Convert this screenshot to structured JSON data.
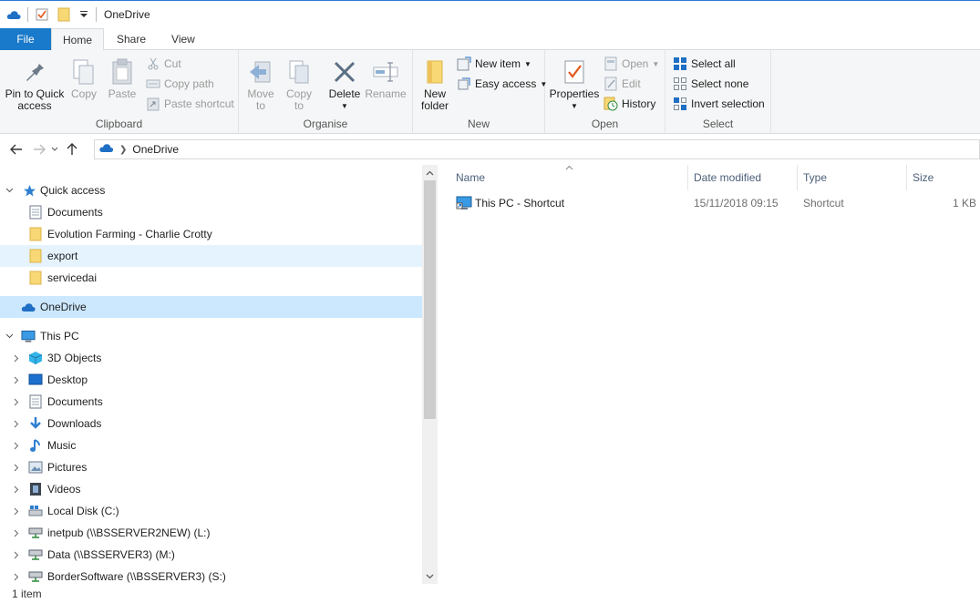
{
  "window": {
    "title": "OneDrive"
  },
  "tabs": [
    {
      "label": "File"
    },
    {
      "label": "Home"
    },
    {
      "label": "Share"
    },
    {
      "label": "View"
    }
  ],
  "ribbon": {
    "clipboard": {
      "label": "Clipboard",
      "pin_line1": "Pin to Quick",
      "pin_line2": "access",
      "copy": "Copy",
      "paste": "Paste",
      "cut": "Cut",
      "copy_path": "Copy path",
      "paste_shortcut": "Paste shortcut"
    },
    "organise": {
      "label": "Organise",
      "move_to": "Move",
      "move_to2": "to",
      "copy_to": "Copy",
      "copy_to2": "to",
      "delete": "Delete",
      "rename": "Rename"
    },
    "new": {
      "label": "New",
      "new_folder1": "New",
      "new_folder2": "folder",
      "new_item": "New item",
      "easy_access": "Easy access"
    },
    "open": {
      "label": "Open",
      "properties": "Properties",
      "open": "Open",
      "edit": "Edit",
      "history": "History"
    },
    "select": {
      "label": "Select",
      "select_all": "Select all",
      "select_none": "Select none",
      "invert": "Invert selection"
    }
  },
  "address": {
    "crumb": "OneDrive"
  },
  "nav": {
    "quick_access": "Quick access",
    "qa_items": [
      {
        "label": "Documents"
      },
      {
        "label": "Evolution Farming - Charlie Crotty"
      },
      {
        "label": "export"
      },
      {
        "label": "servicedai"
      }
    ],
    "onedrive": "OneDrive",
    "this_pc": "This PC",
    "pc_items": [
      {
        "label": "3D Objects"
      },
      {
        "label": "Desktop"
      },
      {
        "label": "Documents"
      },
      {
        "label": "Downloads"
      },
      {
        "label": "Music"
      },
      {
        "label": "Pictures"
      },
      {
        "label": "Videos"
      },
      {
        "label": "Local Disk (C:)"
      },
      {
        "label": "inetpub (\\\\BSSERVER2NEW) (L:)"
      },
      {
        "label": "Data (\\\\BSSERVER3) (M:)"
      },
      {
        "label": "BorderSoftware (\\\\BSSERVER3) (S:)"
      }
    ]
  },
  "columns": {
    "name": "Name",
    "date": "Date modified",
    "type": "Type",
    "size": "Size"
  },
  "files": [
    {
      "name": "This PC - Shortcut",
      "date": "15/11/2018 09:15",
      "type": "Shortcut",
      "size": "1 KB"
    }
  ],
  "status": {
    "text": "1 item"
  },
  "colors": {
    "accent": "#1979ca",
    "selected": "#cce8ff",
    "hover": "#e5f3ff",
    "folder": "#f8d775"
  }
}
